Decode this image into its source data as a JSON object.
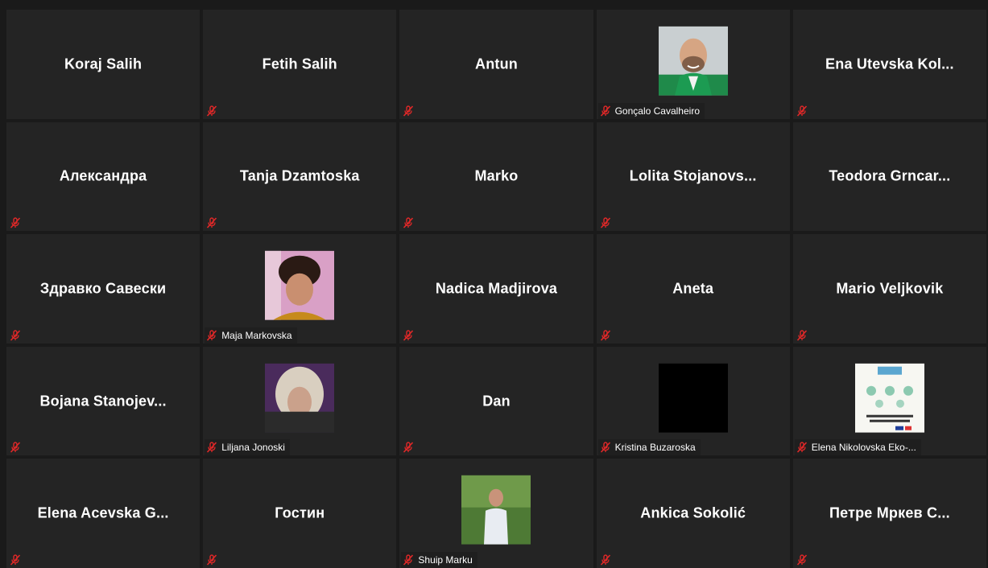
{
  "participants": [
    {
      "name": "Koraj Salih",
      "label": "",
      "muted_icon": false,
      "avatar": ""
    },
    {
      "name": "Fetih Salih",
      "label": "",
      "muted_icon": true,
      "avatar": ""
    },
    {
      "name": "Antun",
      "label": "",
      "muted_icon": true,
      "avatar": ""
    },
    {
      "name": "",
      "label": "Gonçalo Cavalheiro",
      "muted_icon": true,
      "avatar": "man-green-jacket"
    },
    {
      "name": "Ena Utevska Kol...",
      "label": "",
      "muted_icon": true,
      "avatar": ""
    },
    {
      "name": "Александра",
      "label": "",
      "muted_icon": true,
      "avatar": ""
    },
    {
      "name": "Tanja Dzamtoska",
      "label": "",
      "muted_icon": true,
      "avatar": ""
    },
    {
      "name": "Marko",
      "label": "",
      "muted_icon": true,
      "avatar": ""
    },
    {
      "name": "Lolita Stojanovs...",
      "label": "",
      "muted_icon": true,
      "avatar": ""
    },
    {
      "name": "Teodora Grncar...",
      "label": "",
      "muted_icon": false,
      "avatar": ""
    },
    {
      "name": "Здравко Савески",
      "label": "",
      "muted_icon": true,
      "avatar": ""
    },
    {
      "name": "",
      "label": "Maja Markovska",
      "muted_icon": true,
      "avatar": "woman-dark-hair"
    },
    {
      "name": "Nadica Madjirova",
      "label": "",
      "muted_icon": true,
      "avatar": ""
    },
    {
      "name": "Aneta",
      "label": "",
      "muted_icon": true,
      "avatar": ""
    },
    {
      "name": "Mario Veljkovik",
      "label": "",
      "muted_icon": true,
      "avatar": ""
    },
    {
      "name": "Bojana Stanojev...",
      "label": "",
      "muted_icon": true,
      "avatar": ""
    },
    {
      "name": "",
      "label": "Liljana Jonoski",
      "muted_icon": true,
      "avatar": "woman-blonde"
    },
    {
      "name": "Dan",
      "label": "",
      "muted_icon": true,
      "avatar": ""
    },
    {
      "name": "",
      "label": "Kristina Buzaroska",
      "muted_icon": true,
      "avatar": "black"
    },
    {
      "name": "",
      "label": "Elena Nikolovska Eko-...",
      "muted_icon": true,
      "avatar": "poster"
    },
    {
      "name": "Elena Acevska G...",
      "label": "",
      "muted_icon": true,
      "avatar": ""
    },
    {
      "name": "Гостин",
      "label": "",
      "muted_icon": true,
      "avatar": ""
    },
    {
      "name": "",
      "label": "Shuip Marku",
      "muted_icon": true,
      "avatar": "man-outdoor"
    },
    {
      "name": "Ankica Sokolić",
      "label": "",
      "muted_icon": true,
      "avatar": ""
    },
    {
      "name": "Петре Мркев С...",
      "label": "",
      "muted_icon": true,
      "avatar": ""
    }
  ],
  "colors": {
    "background": "#1a1a1a",
    "tile": "#242424",
    "mute_icon": "#e02828",
    "text": "#ffffff"
  }
}
